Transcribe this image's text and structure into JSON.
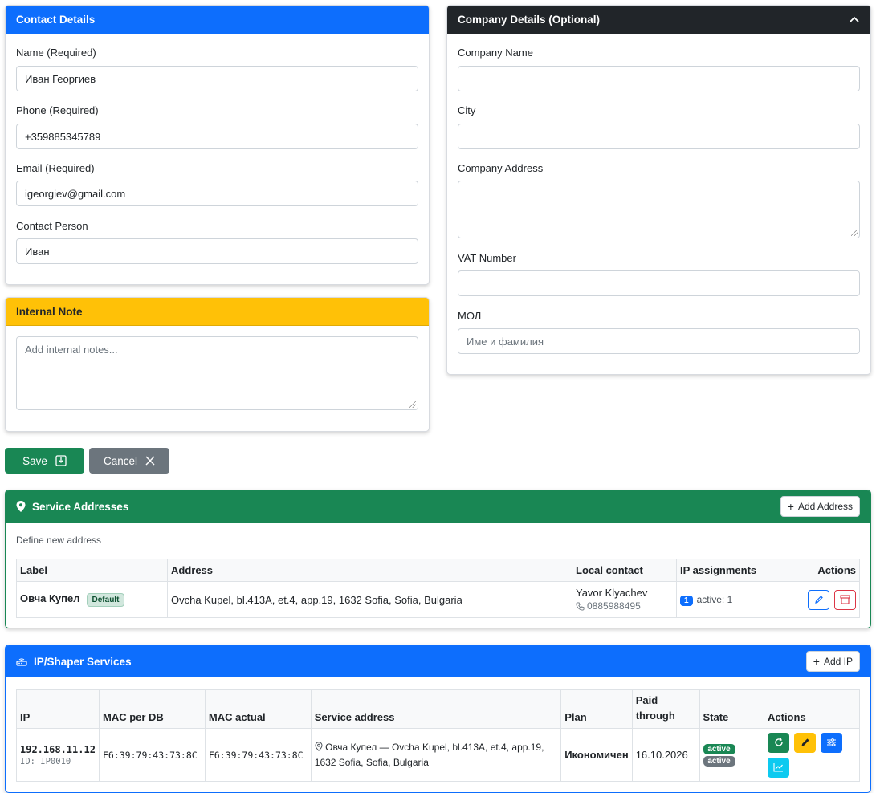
{
  "contact": {
    "title": "Contact Details",
    "name_label": "Name (Required)",
    "name_value": "Иван Георгиев",
    "phone_label": "Phone (Required)",
    "phone_value": "+359885345789",
    "email_label": "Email (Required)",
    "email_value": "igeorgiev@gmail.com",
    "person_label": "Contact Person",
    "person_value": "Иван"
  },
  "note": {
    "title": "Internal Note",
    "placeholder": "Add internal notes..."
  },
  "company": {
    "title": "Company Details (Optional)",
    "name_label": "Company Name",
    "city_label": "City",
    "address_label": "Company Address",
    "vat_label": "VAT Number",
    "mol_label": "МОЛ",
    "mol_placeholder": "Име и фамилия"
  },
  "actions": {
    "save_label": "Save",
    "cancel_label": "Cancel"
  },
  "addresses": {
    "title": "Service Addresses",
    "add_label": "Add Address",
    "subtitle": "Define new address",
    "headers": [
      "Label",
      "Address",
      "Local contact",
      "IP assignments",
      "Actions"
    ],
    "rows": [
      {
        "label": "Овча Купел",
        "badge": "Default",
        "address": "Ovcha Kupel, bl.413A, et.4, app.19, 1632 Sofia, Sofia, Bulgaria",
        "contact_name": "Yavor Klyachev",
        "contact_phone": "0885988495",
        "ip_count": "1",
        "ip_active": "active: 1"
      }
    ]
  },
  "ip_services": {
    "title": "IP/Shaper Services",
    "add_label": "Add IP",
    "headers": [
      "IP",
      "MAC per DB",
      "MAC actual",
      "Service address",
      "Plan",
      "Paid through",
      "State",
      "Actions"
    ],
    "rows": [
      {
        "ip": "192.168.11.12",
        "id": "ID: IP0010",
        "mac_db": "F6:39:79:43:73:8C",
        "mac_actual": "F6:39:79:43:73:8C",
        "service_address": "Овча Купел — Ovcha Kupel, bl.413A, et.4, app.19, 1632 Sofia, Sofia, Bulgaria",
        "plan": "Икономичен",
        "paid_through": "16.10.2026",
        "state1": "active",
        "state2": "active"
      }
    ]
  },
  "colors": {
    "primary": "#0d6efd",
    "success": "#198754",
    "warning": "#ffc107",
    "dark": "#212529",
    "secondary": "#6c757d",
    "info": "#0dcaf0"
  }
}
